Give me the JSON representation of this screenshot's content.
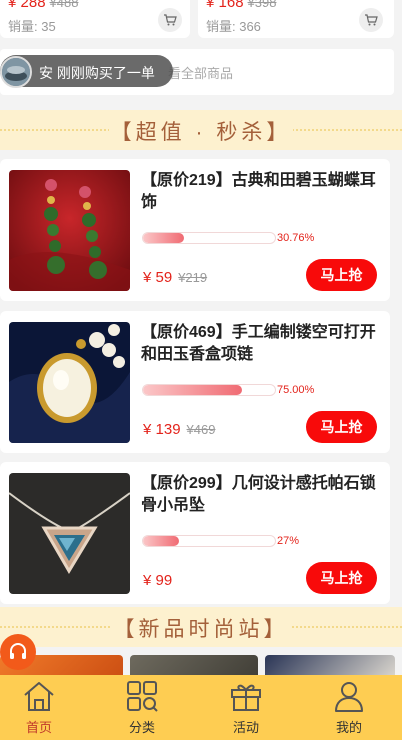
{
  "top_products": [
    {
      "price": "¥ 288",
      "original_price": "¥488",
      "sales": "销量: 35"
    },
    {
      "price": "¥ 168",
      "original_price": "¥398",
      "sales": "销量: 366"
    }
  ],
  "notice": {
    "toast_text": "安 刚刚购买了一单",
    "view_all": "看全部商品"
  },
  "sections": {
    "flash_sale": "【超值 · 秒杀】",
    "new_arrivals": "【新品时尚站】"
  },
  "flash_sale_items": [
    {
      "title": "【原价219】古典和田碧玉蝴蝶耳饰",
      "progress_text": "30.76%",
      "progress": 0.3076,
      "price": "¥ 59",
      "original_price": "¥219",
      "buy_label": "马上抢"
    },
    {
      "title": "【原价469】手工编制镂空可打开和田玉香盒项链",
      "progress_text": "75.00%",
      "progress": 0.75,
      "price": "¥ 139",
      "original_price": "¥469",
      "buy_label": "马上抢"
    },
    {
      "title": "【原价299】几何设计感托帕石锁骨小吊坠",
      "progress_text": "27%",
      "progress": 0.27,
      "price": "¥ 99",
      "original_price": "",
      "buy_label": "马上抢"
    }
  ],
  "tabbar": {
    "items": [
      {
        "label": "首页",
        "icon": "home-icon",
        "active": true
      },
      {
        "label": "分类",
        "icon": "category-icon",
        "active": false
      },
      {
        "label": "活动",
        "icon": "gift-icon",
        "active": false
      },
      {
        "label": "我的",
        "icon": "user-icon",
        "active": false
      }
    ]
  },
  "colors": {
    "accent_red": "#e3231b",
    "buy_button": "#f80a0a",
    "tabbar_bg": "#fecd52",
    "section_bg": "#fdf1cf",
    "section_text": "#a4603a"
  }
}
